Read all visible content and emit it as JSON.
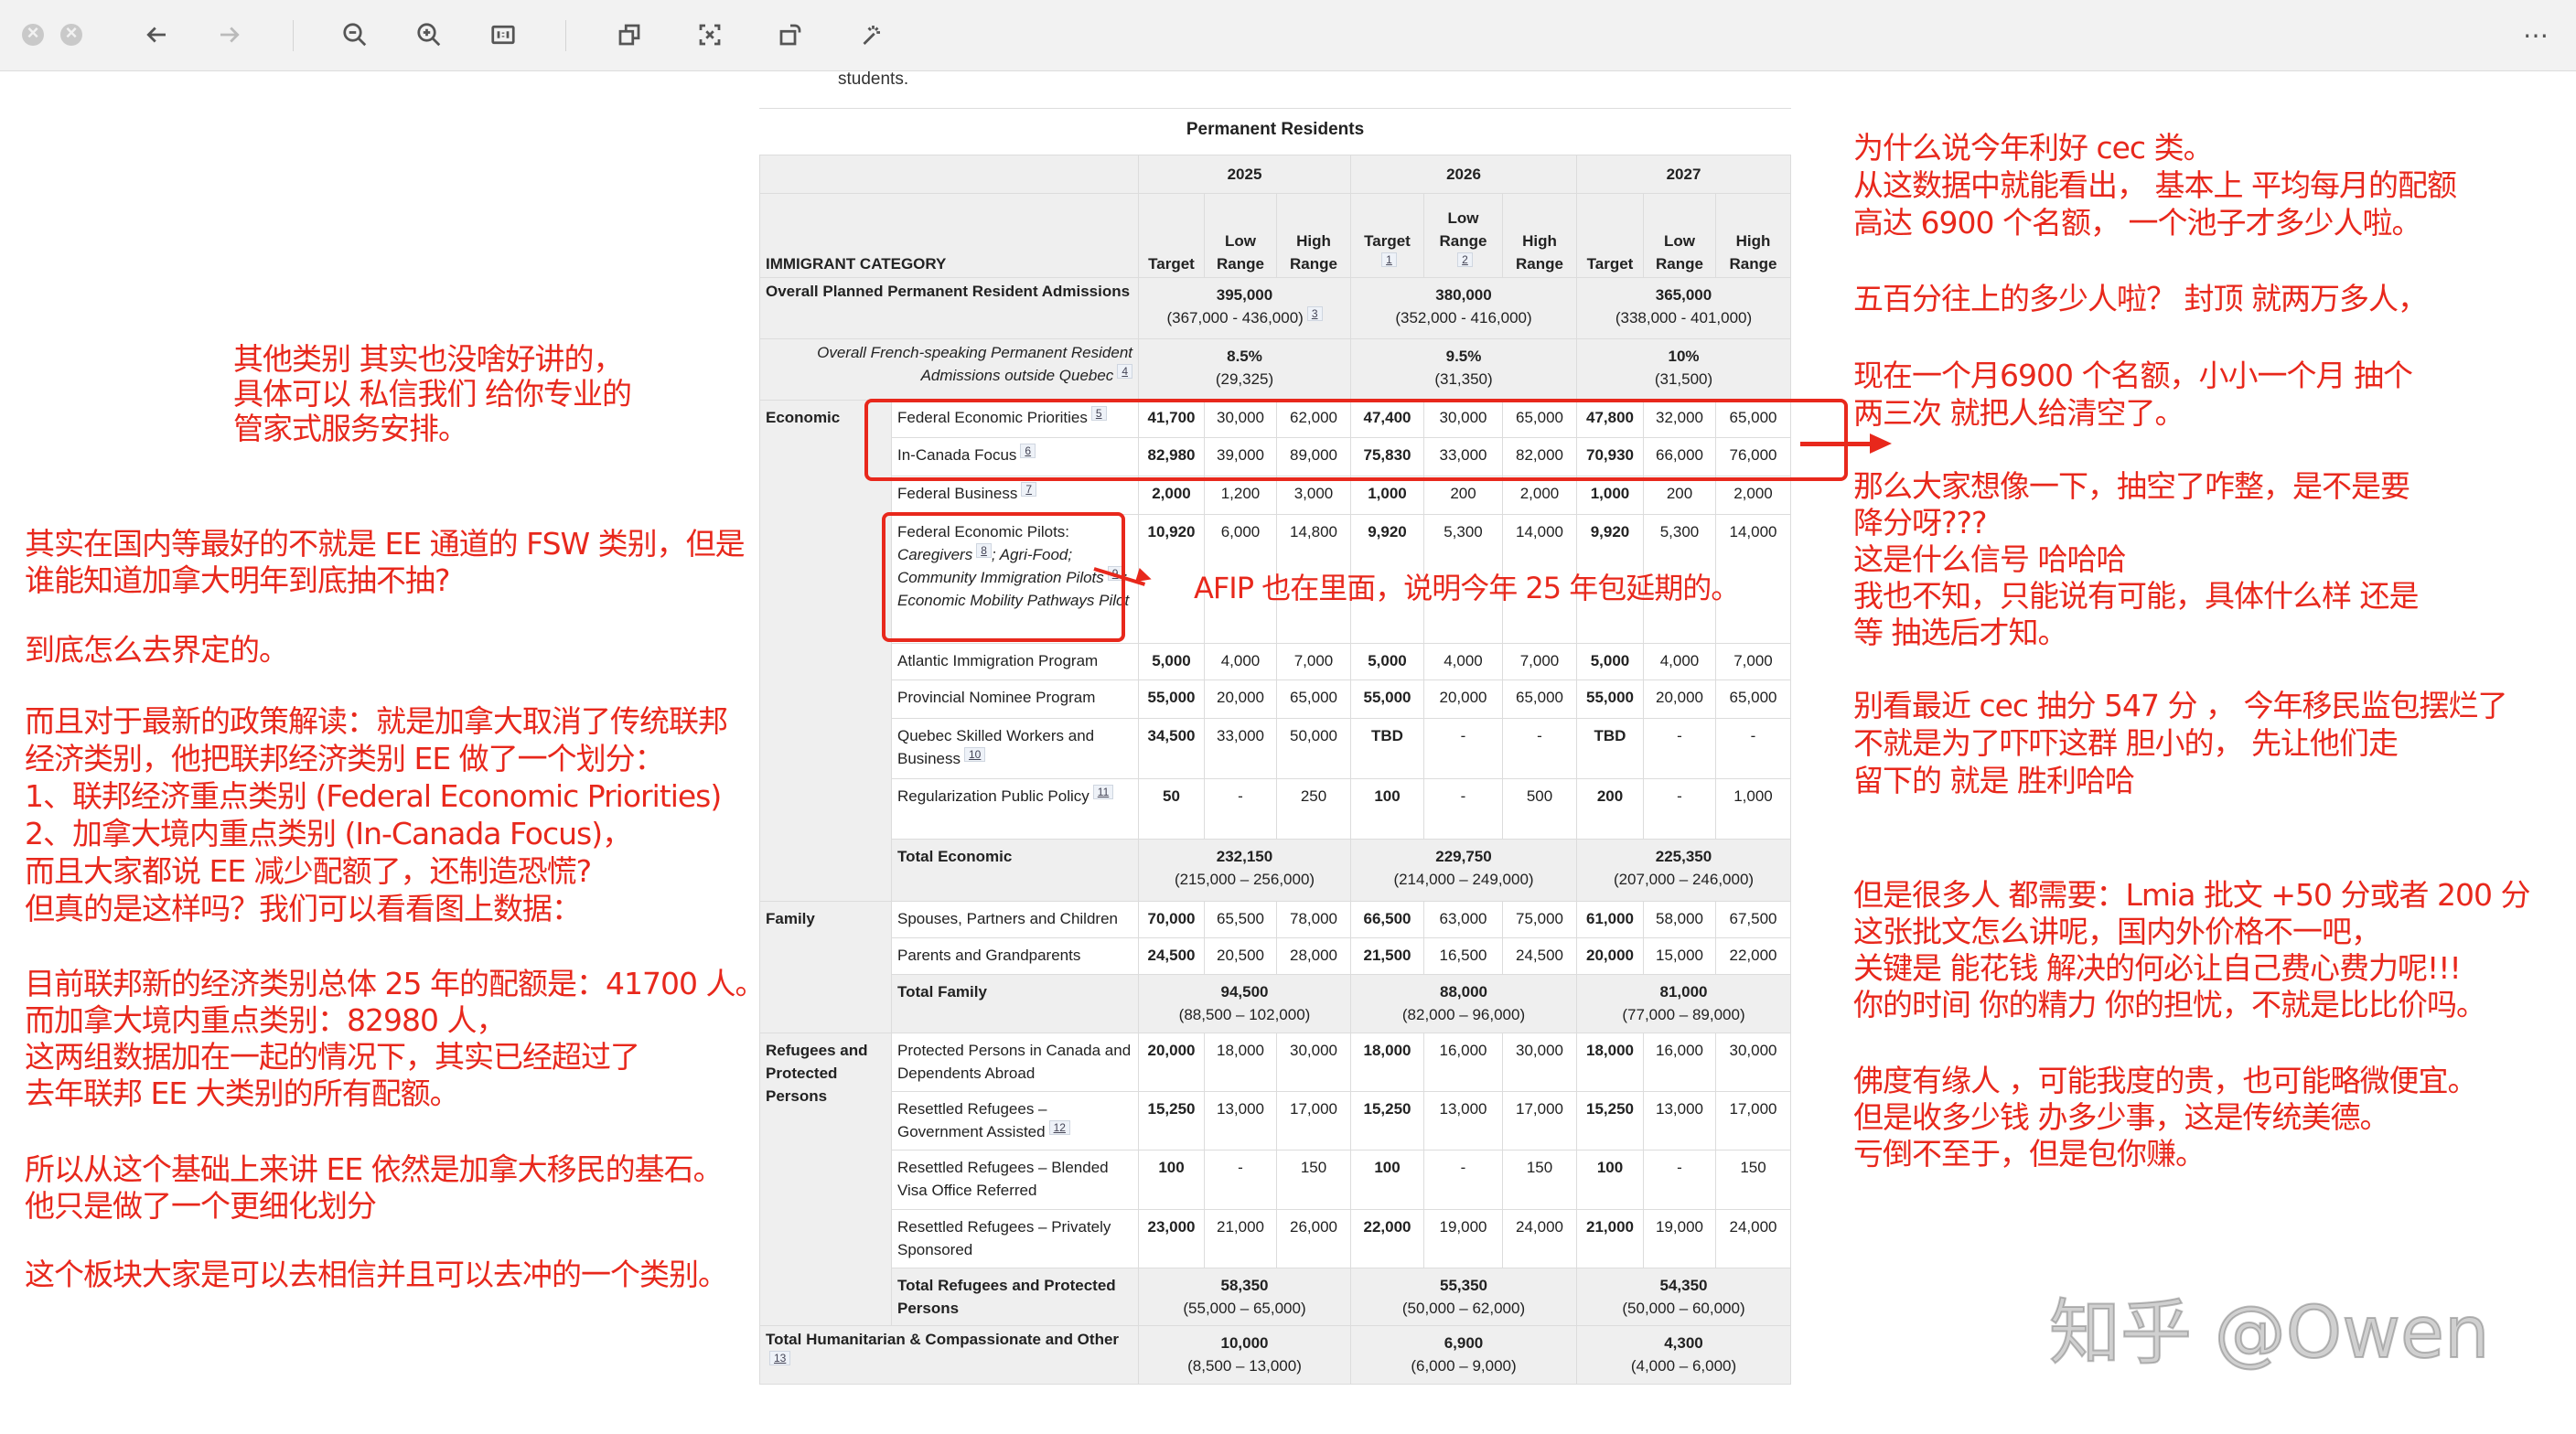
{
  "toolbar": {
    "icons": [
      "close-icon",
      "minimize-icon",
      "back-arrow-icon",
      "forward-arrow-icon",
      "zoom-out-icon",
      "zoom-in-icon",
      "actual-size-icon",
      "window-icon",
      "crop-icon",
      "rotate-icon",
      "magic-wand-icon",
      "more-icon"
    ]
  },
  "page": {
    "students_text": "students."
  },
  "table": {
    "title": "Permanent Residents",
    "category_header": "IMMIGRANT CATEGORY",
    "years": [
      "2025",
      "2026",
      "2027"
    ],
    "subheaders": [
      {
        "target": "Target",
        "target_note": "",
        "low": "Low Range",
        "low_note": "",
        "high": "High Range"
      },
      {
        "target": "Target",
        "target_note": "1",
        "low": "Low Range",
        "low_note": "2",
        "high": "High Range"
      },
      {
        "target": "Target",
        "target_note": "",
        "low": "Low Range",
        "low_note": "",
        "high": "High Range"
      }
    ],
    "summary_rows": [
      {
        "label": "Overall Planned Permanent Resident Admissions",
        "note": "",
        "italic": false,
        "years": [
          {
            "value": "395,000",
            "range": "(367,000 - 436,000)",
            "note": "3"
          },
          {
            "value": "380,000",
            "range": "(352,000 - 416,000)",
            "note": ""
          },
          {
            "value": "365,000",
            "range": "(338,000 - 401,000)",
            "note": ""
          }
        ]
      },
      {
        "label": "Overall French-speaking Permanent Resident Admissions outside Quebec",
        "note": "4",
        "italic": true,
        "years": [
          {
            "value": "8.5%",
            "range": "(29,325)",
            "note": ""
          },
          {
            "value": "9.5%",
            "range": "(31,350)",
            "note": ""
          },
          {
            "value": "10%",
            "range": "(31,500)",
            "note": ""
          }
        ]
      }
    ],
    "groups": [
      {
        "name": "Economic",
        "rows": [
          {
            "parts": [
              {
                "text": "Federal Economic Priorities",
                "note": "5",
                "italic": false
              }
            ],
            "values": [
              "41,700",
              "30,000",
              "62,000",
              "47,400",
              "30,000",
              "65,000",
              "47,800",
              "32,000",
              "65,000"
            ]
          },
          {
            "parts": [
              {
                "text": "In-Canada Focus",
                "note": "6",
                "italic": false
              }
            ],
            "values": [
              "82,980",
              "39,000",
              "89,000",
              "75,830",
              "33,000",
              "82,000",
              "70,930",
              "66,000",
              "76,000"
            ]
          },
          {
            "parts": [
              {
                "text": "Federal Business",
                "note": "7",
                "italic": false
              }
            ],
            "values": [
              "2,000",
              "1,200",
              "3,000",
              "1,000",
              "200",
              "2,000",
              "1,000",
              "200",
              "2,000"
            ]
          },
          {
            "parts": [
              {
                "text": "Federal Economic Pilots: ",
                "note": "",
                "italic": false
              },
              {
                "text": "Caregivers",
                "note": "8",
                "italic": true
              },
              {
                "text": "; Agri-Food; Community Immigration Pilots",
                "note": "9",
                "italic": true
              },
              {
                "text": "; Economic Mobility Pathways Pilot",
                "note": "",
                "italic": true
              }
            ],
            "values": [
              "10,920",
              "6,000",
              "14,800",
              "9,920",
              "5,300",
              "14,000",
              "9,920",
              "5,300",
              "14,000"
            ]
          },
          {
            "parts": [
              {
                "text": "Atlantic Immigration Program",
                "note": "",
                "italic": false
              }
            ],
            "values": [
              "5,000",
              "4,000",
              "7,000",
              "5,000",
              "4,000",
              "7,000",
              "5,000",
              "4,000",
              "7,000"
            ]
          },
          {
            "parts": [
              {
                "text": "Provincial Nominee Program",
                "note": "",
                "italic": false
              }
            ],
            "values": [
              "55,000",
              "20,000",
              "65,000",
              "55,000",
              "20,000",
              "65,000",
              "55,000",
              "20,000",
              "65,000"
            ]
          },
          {
            "parts": [
              {
                "text": "Quebec Skilled Workers and Business",
                "note": "10",
                "italic": false
              }
            ],
            "values": [
              "34,500",
              "33,000",
              "50,000",
              "TBD",
              "-",
              "-",
              "TBD",
              "-",
              "-"
            ]
          },
          {
            "parts": [
              {
                "text": "Regularization Public Policy",
                "note": "11",
                "italic": false
              }
            ],
            "values": [
              "50",
              "-",
              "250",
              "100",
              "-",
              "500",
              "200",
              "-",
              "1,000"
            ]
          }
        ],
        "total": {
          "label": "Total Economic",
          "years": [
            {
              "value": "232,150",
              "range": "(215,000 – 256,000)"
            },
            {
              "value": "229,750",
              "range": "(214,000 – 249,000)"
            },
            {
              "value": "225,350",
              "range": "(207,000 – 246,000)"
            }
          ]
        }
      },
      {
        "name": "Family",
        "rows": [
          {
            "parts": [
              {
                "text": "Spouses, Partners and Children",
                "note": "",
                "italic": false
              }
            ],
            "values": [
              "70,000",
              "65,500",
              "78,000",
              "66,500",
              "63,000",
              "75,000",
              "61,000",
              "58,000",
              "67,500"
            ]
          },
          {
            "parts": [
              {
                "text": "Parents and Grandparents",
                "note": "",
                "italic": false
              }
            ],
            "values": [
              "24,500",
              "20,500",
              "28,000",
              "21,500",
              "16,500",
              "24,500",
              "20,000",
              "15,000",
              "22,000"
            ]
          }
        ],
        "total": {
          "label": "Total Family",
          "years": [
            {
              "value": "94,500",
              "range": "(88,500 – 102,000)"
            },
            {
              "value": "88,000",
              "range": "(82,000 – 96,000)"
            },
            {
              "value": "81,000",
              "range": "(77,000 – 89,000)"
            }
          ]
        }
      },
      {
        "name": "Refugees and Protected Persons",
        "rows": [
          {
            "parts": [
              {
                "text": "Protected Persons in Canada and Dependents Abroad",
                "note": "",
                "italic": false
              }
            ],
            "values": [
              "20,000",
              "18,000",
              "30,000",
              "18,000",
              "16,000",
              "30,000",
              "18,000",
              "16,000",
              "30,000"
            ]
          },
          {
            "parts": [
              {
                "text": "Resettled Refugees – Government Assisted",
                "note": "12",
                "italic": false
              }
            ],
            "values": [
              "15,250",
              "13,000",
              "17,000",
              "15,250",
              "13,000",
              "17,000",
              "15,250",
              "13,000",
              "17,000"
            ]
          },
          {
            "parts": [
              {
                "text": "Resettled Refugees – Blended Visa Office Referred",
                "note": "",
                "italic": false
              }
            ],
            "values": [
              "100",
              "-",
              "150",
              "100",
              "-",
              "150",
              "100",
              "-",
              "150"
            ]
          },
          {
            "parts": [
              {
                "text": "Resettled Refugees – Privately Sponsored",
                "note": "",
                "italic": false
              }
            ],
            "values": [
              "23,000",
              "21,000",
              "26,000",
              "22,000",
              "19,000",
              "24,000",
              "21,000",
              "19,000",
              "24,000"
            ]
          }
        ],
        "total": {
          "label": "Total Refugees and Protected Persons",
          "years": [
            {
              "value": "58,350",
              "range": "(55,000 – 65,000)"
            },
            {
              "value": "55,350",
              "range": "(50,000 – 62,000)"
            },
            {
              "value": "54,350",
              "range": "(50,000 – 60,000)"
            }
          ]
        }
      }
    ],
    "footer_row": {
      "label": "Total Humanitarian & Compassionate and Other",
      "note": "13",
      "years": [
        {
          "value": "10,000",
          "range": "(8,500 – 13,000)"
        },
        {
          "value": "6,900",
          "range": "(6,000 – 9,000)"
        },
        {
          "value": "4,300",
          "range": "(4,000 – 6,000)"
        }
      ]
    }
  },
  "annotations": {
    "accent": "#e8281c",
    "afip": "AFIP 也在里面，说明今年 25 年包延期的。",
    "left": [
      [
        "其他类别 其实也没啥好讲的，",
        "具体可以 私信我们 给你专业的",
        "管家式服务安排。"
      ],
      [
        "其实在国内等最好的不就是 EE 通道的 FSW 类别，但是",
        "谁能知道加拿大明年到底抽不抽?"
      ],
      [
        "到底怎么去界定的。"
      ],
      [
        "而且对于最新的政策解读：就是加拿大取消了传统联邦",
        "经济类别，他把联邦经济类别 EE 做了一个划分：",
        "1、联邦经济重点类别 (Federal Economic Priorities)",
        " 2、加拿大境内重点类别 (In-Canada Focus)，",
        "而且大家都说 EE 减少配额了，还制造恐慌?",
        "但真的是这样吗？我们可以看看图上数据："
      ],
      [
        "目前联邦新的经济类别总体 25 年的配额是：41700 人。",
        "而加拿大境内重点类别：82980 人，",
        "这两组数据加在一起的情况下，其实已经超过了",
        "去年联邦 EE 大类别的所有配额。"
      ],
      [
        "所以从这个基础上来讲 EE 依然是加拿大移民的基石。",
        "他只是做了一个更细化划分"
      ],
      [
        "这个板块大家是可以去相信并且可以去冲的一个类别。"
      ]
    ],
    "right": [
      [
        "为什么说今年利好 cec 类。",
        "从这数据中就能看出， 基本上 平均每月的配额",
        "高达 6900 个名额， 一个池子才多少人啦。"
      ],
      [
        "五百分往上的多少人啦？ 封顶 就两万多人，"
      ],
      [
        "现在一个月6900 个名额，小小一个月 抽个",
        "两三次 就把人给清空了。"
      ],
      [
        "那么大家想像一下，抽空了咋整，是不是要",
        "降分呀???",
        " 这是什么信号 哈哈哈",
        "我也不知，只能说有可能，具体什么样 还是",
        "等 抽选后才知。"
      ],
      [
        "别看最近 cec 抽分 547 分 ，  今年移民监包摆烂了",
        " 不就是为了吓吓这群 胆小的，  先让他们走",
        "留下的 就是 胜利哈哈"
      ],
      [
        "但是很多人 都需要：Lmia 批文 +50 分或者 200 分",
        "这张批文怎么讲呢，国内外价格不一吧，",
        "关键是 能花钱 解决的何必让自己费心费力呢!!!",
        "你的时间 你的精力 你的担忧，不就是比比价吗。"
      ],
      [
        "佛度有缘人 ，可能我度的贵，也可能略微便宜。",
        "但是收多少钱 办多少事，这是传统美德。",
        "亏倒不至于，但是包你赚。"
      ]
    ]
  },
  "watermark": "知乎 @Owen"
}
